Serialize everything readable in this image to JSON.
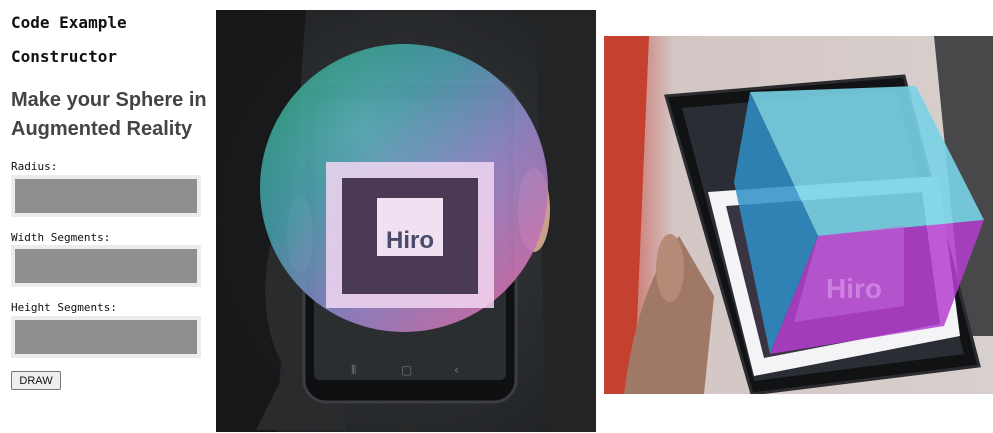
{
  "sidebar": {
    "code_title": "Code Example Constructor",
    "heading": "Make your Sphere in Augmented Reality",
    "fields": [
      {
        "label": "Radius:",
        "value": ""
      },
      {
        "label": "Width Segments:",
        "value": ""
      },
      {
        "label": "Height Segments:",
        "value": ""
      }
    ],
    "draw_label": "DRAW"
  },
  "photos": {
    "sphere": {
      "marker_text": "Hiro"
    },
    "cube": {
      "marker_text": "Hiro"
    }
  },
  "colors": {
    "input_fill": "#8f8f8f",
    "input_border": "#ececec",
    "heading": "#444444",
    "sphere_pink": "#e08ad6",
    "sphere_teal": "#1f9f9a",
    "cube_cyan": "#6ecbe0",
    "cube_magenta": "#b33fcf"
  }
}
